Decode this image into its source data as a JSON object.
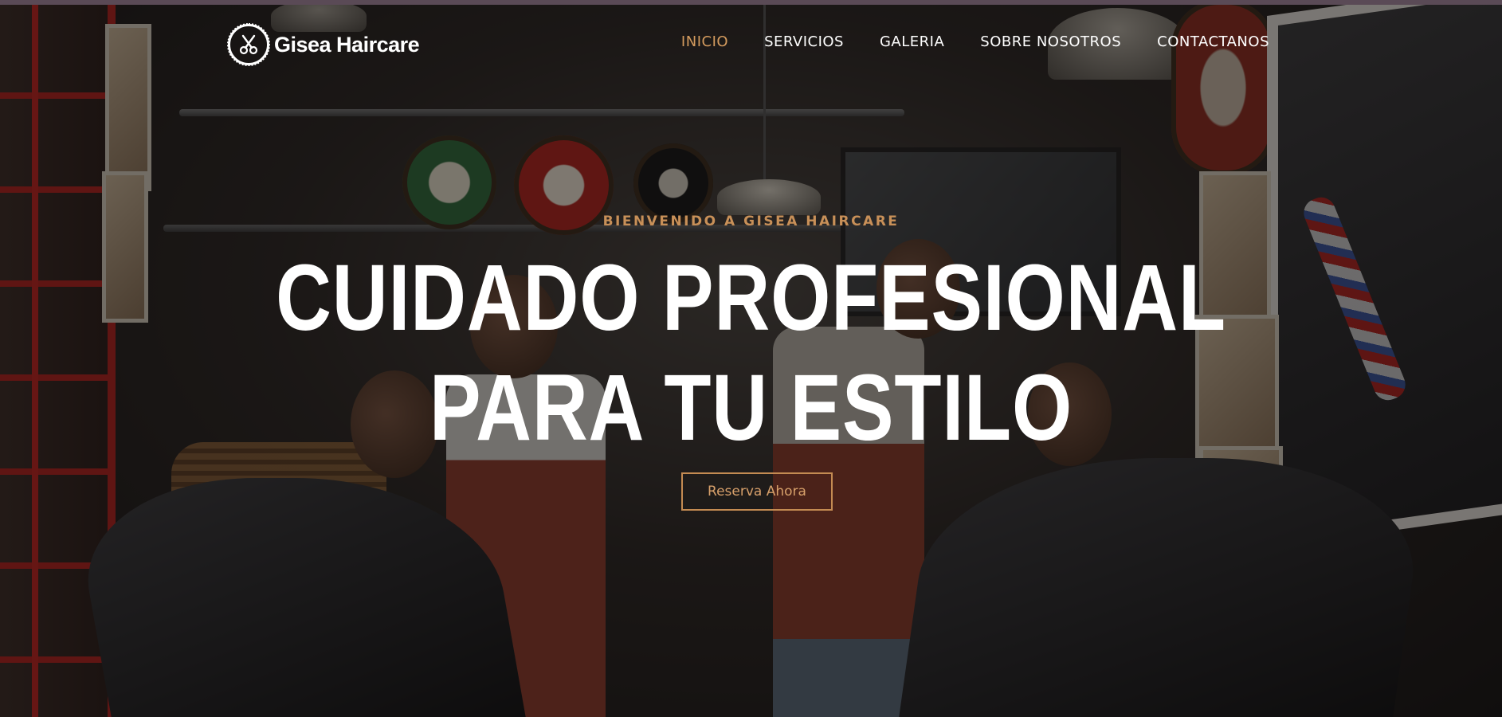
{
  "brand": {
    "name": "Gisea Haircare",
    "logo_icon": "scissors-icon"
  },
  "nav": {
    "items": [
      {
        "label": "INICIO",
        "active": true
      },
      {
        "label": "SERVICIOS",
        "active": false
      },
      {
        "label": "GALERIA",
        "active": false
      },
      {
        "label": "SOBRE NOSOTROS",
        "active": false
      },
      {
        "label": "CONTACTANOS",
        "active": false
      }
    ]
  },
  "hero": {
    "eyebrow": "BIENVENIDO A GISEA HAIRCARE",
    "headline_line1": "CUIDADO PROFESIONAL",
    "headline_line2": "PARA TU ESTILO",
    "cta_label": "Reserva Ahora"
  },
  "colors": {
    "accent": "#c89058",
    "text": "#ffffff",
    "overlay": "#0c0a09"
  }
}
